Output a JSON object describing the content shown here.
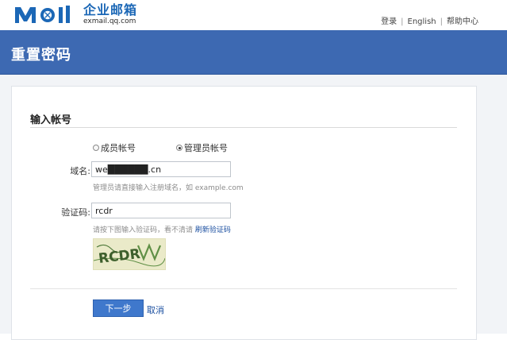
{
  "header": {
    "logo": {
      "mark": "Mail",
      "name_cn": "企业邮箱",
      "domain": "exmail.qq.com"
    },
    "links": [
      "登录",
      "English",
      "帮助中心"
    ]
  },
  "page": {
    "title": "重置密码"
  },
  "form": {
    "section_title": "输入帐号",
    "account_types": {
      "member": "成员帐号",
      "admin": "管理员帐号",
      "selected": "admin"
    },
    "domain": {
      "label": "域名:",
      "value": "we██████.cn",
      "hint": "管理员请直接输入注册域名，如 example.com"
    },
    "captcha": {
      "label": "验证码:",
      "value": "rcdr",
      "hint_prefix": "请按下图输入验证码，看不清请",
      "refresh_link": "刷新验证码",
      "image_text": "RCDR"
    },
    "actions": {
      "next": "下一步",
      "cancel": "取消"
    }
  },
  "colors": {
    "brand_blue": "#3d69b2",
    "button_blue": "#3f78cc",
    "link_blue": "#1b4fa0",
    "captcha_bg": "#eaeac9"
  }
}
